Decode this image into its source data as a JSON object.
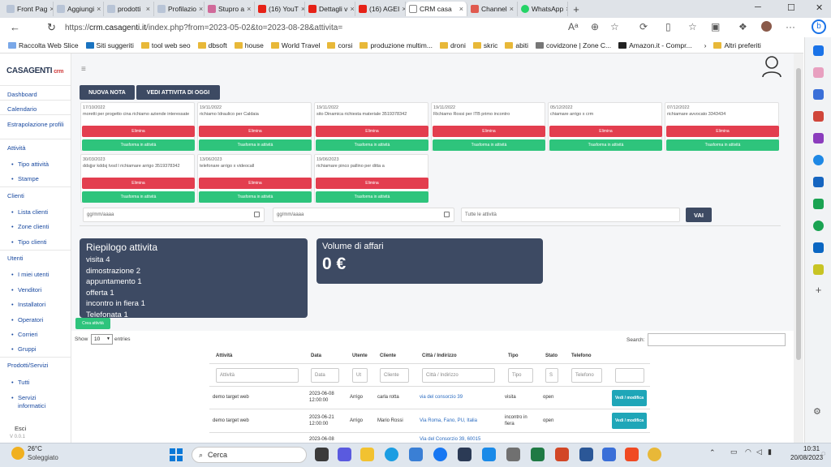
{
  "browser": {
    "tabs": [
      {
        "label": "Front Pag",
        "icon": "blog-favicon-icon"
      },
      {
        "label": "Aggiungi",
        "icon": "blog-favicon-icon"
      },
      {
        "label": "prodotti",
        "icon": "blog-favicon-icon"
      },
      {
        "label": "Profilazio",
        "icon": "blog-favicon-icon"
      },
      {
        "label": "Stupro a",
        "icon": "news-favicon-icon"
      },
      {
        "label": "(16) YouT",
        "icon": "youtube-icon"
      },
      {
        "label": "Dettagli v",
        "icon": "youtube-icon"
      },
      {
        "label": "(16) AGEI",
        "icon": "youtube-icon"
      },
      {
        "label": "CRM casa",
        "icon": "page-icon",
        "active": true
      },
      {
        "label": "Channel",
        "icon": "channel-icon"
      },
      {
        "label": "WhatsApp",
        "icon": "whatsapp-icon"
      }
    ],
    "url_prefix": "https://",
    "url_host": "crm.casagenti.it",
    "url_path": "/index.php?from=2023-05-02&to=2023-08-28&attivita=",
    "bookmarks": [
      "Raccolta Web Slice",
      "Siti suggeriti",
      "tool web seo",
      "dbsoft",
      "house",
      "World Travel",
      "corsi",
      "produzione multim...",
      "droni",
      "skric",
      "abiti",
      "covidzone | Zone C...",
      "Amazon.it - Compr..."
    ],
    "other_bookmarks": "Altri preferiti"
  },
  "sidebar": {
    "logo_main": "CASAGENTI",
    "logo_sub": "crm",
    "items": [
      {
        "label": "Dashboard",
        "type": "link"
      },
      {
        "label": "Calendario",
        "type": "link"
      },
      {
        "label": "Estrapolazione profili",
        "type": "link"
      },
      {
        "label": "Attività",
        "type": "link"
      },
      {
        "label": "Tipo attività",
        "type": "sub"
      },
      {
        "label": "Stampe",
        "type": "sub"
      },
      {
        "label": "Clienti",
        "type": "link"
      },
      {
        "label": "Lista clienti",
        "type": "sub"
      },
      {
        "label": "Zone clienti",
        "type": "sub"
      },
      {
        "label": "Tipo clienti",
        "type": "sub"
      },
      {
        "label": "Utenti",
        "type": "link"
      },
      {
        "label": "I miei utenti",
        "type": "sub"
      },
      {
        "label": "Venditori",
        "type": "sub"
      },
      {
        "label": "Installatori",
        "type": "sub"
      },
      {
        "label": "Operatori",
        "type": "sub"
      },
      {
        "label": "Corrieri",
        "type": "sub"
      },
      {
        "label": "Gruppi",
        "type": "sub"
      },
      {
        "label": "Prodotti/Servizi",
        "type": "link"
      },
      {
        "label": "Tutti",
        "type": "sub"
      },
      {
        "label": "Servizi informatici",
        "type": "sub"
      }
    ],
    "logout": "Esci",
    "version": "V 0.0.1"
  },
  "toolbar": {
    "new_note": "NUOVA NOTA",
    "today": "VEDI ATTIVITA DI OGGI"
  },
  "notes": [
    {
      "date": "17/10/2022",
      "text": "moretti per progetto cina richiamo aziende interessate"
    },
    {
      "date": "19/11/2022",
      "text": "richiamo Idraulico per Caldaia"
    },
    {
      "date": "19/11/2022",
      "text": "sito Dinamica richiesta materiale 3519378342"
    },
    {
      "date": "19/11/2022",
      "text": "Richiamo Rossi per ITB primo incontro"
    },
    {
      "date": "05/12/2022",
      "text": "chiamare arrigo x crm"
    },
    {
      "date": "07/12/2022",
      "text": "richiamare avvocato 3343434"
    },
    {
      "date": "30/03/2023",
      "text": "ddsjjsr kddsj tvsd l richiamare arrigo 3519378342"
    },
    {
      "date": "13/06/2023",
      "text": "telefonare arrigo x videocall"
    },
    {
      "date": "19/06/2023",
      "text": "richiamare pinco pallino per ditta a"
    }
  ],
  "note_actions": {
    "delete": "Elimina",
    "convert": "Trasforma in attività"
  },
  "filter": {
    "from_placeholder": "gg/mm/aaaa",
    "to_placeholder": "gg/mm/aaaa",
    "type_value": "Tutte le attività",
    "go": "VAI"
  },
  "summary": {
    "title": "Riepilogo attivita",
    "lines": [
      "visita 4",
      "dimostrazione 2",
      "appuntamento 1",
      "offerta 1",
      "incontro in fiera 1",
      "Telefonata 1"
    ]
  },
  "volume": {
    "title": "Volume di affari",
    "value": "0 €"
  },
  "table": {
    "create_button": "Crea attività",
    "show_label": "Show",
    "entries_value": "10",
    "entries_label": "entries",
    "search_label": "Search:",
    "headers": [
      "Attività",
      "Data",
      "Utente",
      "Cliente",
      "Città / Indirizzo",
      "Tipo",
      "Stato",
      "Telefono"
    ],
    "filters": [
      "Attività",
      "Data",
      "Ut",
      "Cliente",
      "Città / Indirizzo",
      "Tipo",
      "S",
      "Telefono"
    ],
    "rows": [
      {
        "attivita": "demo target web",
        "data": "2023-06-08 12:00:00",
        "utente": "Arrigo",
        "cliente": "carla rotta",
        "citta": "via del consorzio 39",
        "tipo": "visita",
        "stato": "open",
        "telefono": ""
      },
      {
        "attivita": "demo target web",
        "data": "2023-06-21 12:00:00",
        "utente": "Arrigo",
        "cliente": "Mario Rossi",
        "citta": "Via Roma, Fano, PU, Italia",
        "tipo": "incontro in fiera",
        "stato": "open",
        "telefono": ""
      },
      {
        "attivita": "",
        "data": "2023-06-08",
        "utente": "",
        "cliente": "",
        "citta": "Via del Consorzio 39, 60015",
        "tipo": "",
        "stato": "",
        "telefono": ""
      }
    ],
    "row_action": "Vedi / modifica"
  },
  "taskbar": {
    "weather_temp": "26°C",
    "weather_desc": "Soleggiato",
    "search": "Cerca",
    "time": "10:31",
    "date": "20/08/2023"
  }
}
